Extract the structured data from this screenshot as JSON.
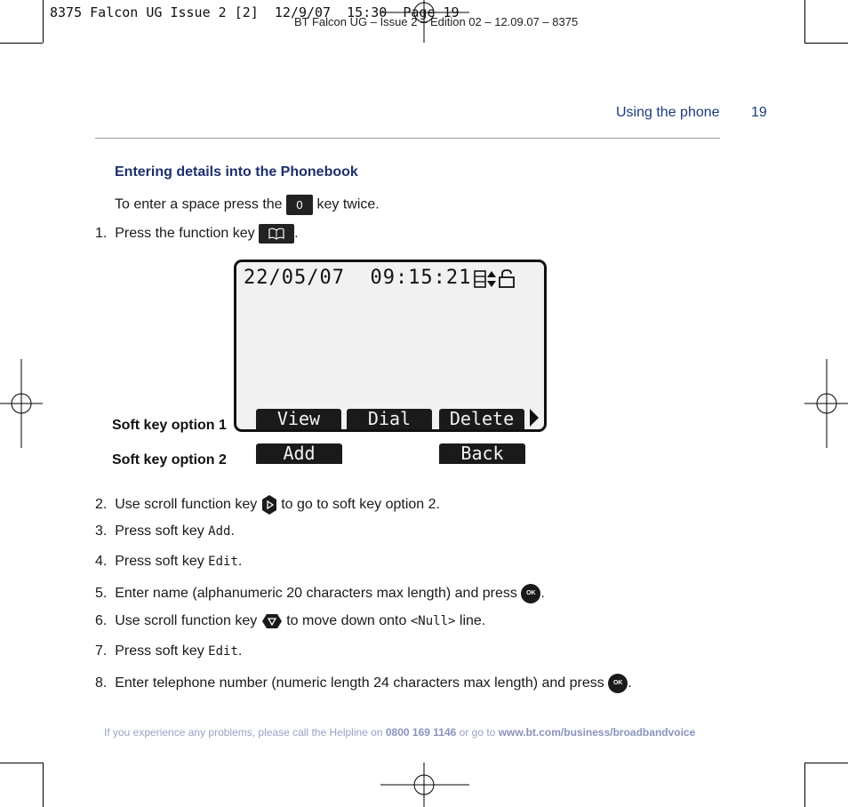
{
  "print_header": {
    "slug": "8375 Falcon UG Issue 2 [2]  12/9/07  15:30  Page 19",
    "subslug": "BT Falcon UG – Issue 2 – Edition 02 – 12.09.07 – 8375"
  },
  "header": {
    "section_title": "Using the phone",
    "page_number": "19"
  },
  "content": {
    "subheading": "Entering details into the Phonebook",
    "space_tip": {
      "before": "To enter a space press the",
      "key": "0",
      "after": "key twice."
    },
    "steps": [
      {
        "num": "1.",
        "before": "Press the function key",
        "key_icon": "phonebook-icon",
        "after": "."
      },
      {
        "num": "2.",
        "before": "Use scroll function key",
        "key_icon": "scroll-right-icon",
        "after": "to go to soft key option 2."
      },
      {
        "num": "3.",
        "before": "Press soft key",
        "lcd": "Add",
        "after": "."
      },
      {
        "num": "4.",
        "before": "Press soft key",
        "lcd": "Edit",
        "after": "."
      },
      {
        "num": "5.",
        "before": "Enter name (alphanumeric 20 characters max length) and press",
        "key_icon": "ok-icon",
        "key_label": "OK",
        "after": "."
      },
      {
        "num": "6.",
        "before": "Use scroll function key",
        "key_icon": "scroll-down-icon",
        "after_prefix": "to move down onto",
        "lcd": "<Null>",
        "after": "line."
      },
      {
        "num": "7.",
        "before": "Press soft key",
        "lcd": "Edit",
        "after": "."
      },
      {
        "num": "8.",
        "before": "Enter telephone number (numeric length 24 characters max length) and press",
        "key_icon": "ok-icon",
        "key_label": "OK",
        "after": "."
      }
    ]
  },
  "screen": {
    "datetime": "22/05/07  09:15:21",
    "status_icons": [
      "signal-icon",
      "updown-icon",
      "lock-icon"
    ],
    "softkeys_row1": [
      "View",
      "Dial",
      "Delete"
    ],
    "softkeys_row2": [
      "Add",
      "Back"
    ],
    "more_arrow_icon": "arrow-right-icon",
    "label_row1": "Soft key option 1",
    "label_row2": "Soft key option 2"
  },
  "footer": {
    "text_before": "If you experience any problems, please call the Helpline on",
    "phone": "0800 169 1146",
    "text_middle": "or go to",
    "url": "www.bt.com/business/broadbandvoice"
  },
  "colors": {
    "heading_blue": "#1d3b7a",
    "footer_blue": "#9aa3c4"
  }
}
